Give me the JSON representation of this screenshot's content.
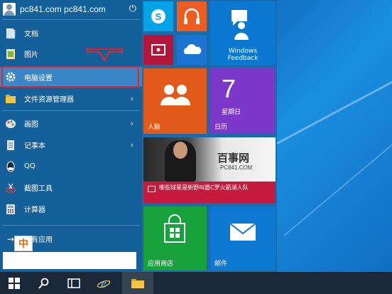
{
  "user": {
    "name": "pc841.com pc841.com"
  },
  "menu": {
    "items": [
      {
        "label": "文档",
        "icon": "documents-icon"
      },
      {
        "label": "图片",
        "icon": "pictures-icon"
      },
      {
        "label": "电脑设置",
        "icon": "gear-icon",
        "selected": true
      },
      {
        "label": "文件资源管理器",
        "icon": "folder-icon",
        "has_arrow": true
      },
      {
        "label": "画图",
        "icon": "paint-icon",
        "has_arrow": true
      },
      {
        "label": "记事本",
        "icon": "notepad-icon",
        "has_arrow": true
      },
      {
        "label": "QQ",
        "icon": "qq-icon"
      },
      {
        "label": "截图工具",
        "icon": "snipping-tool-icon"
      },
      {
        "label": "计算器",
        "icon": "calculator-icon"
      }
    ],
    "all_apps": "所有应用",
    "arrow_glyph": "›"
  },
  "ime": {
    "label": "中"
  },
  "tiles": {
    "feedback": {
      "label": "Windows\nFeedback"
    },
    "people": {
      "label": "人脉"
    },
    "calendar": {
      "label": "日历",
      "day": "7",
      "weekday": "星期日"
    },
    "news": {
      "caption": "哪些球星是新野叫嚣C罗火箭湖人队",
      "watermark": "百事网",
      "watermark_url": "PC841.COM"
    },
    "store": {
      "label": "应用商店"
    },
    "mail": {
      "label": "邮件"
    }
  },
  "colors": {
    "accent_red": "#e3262e",
    "menu_bg": "#14609b",
    "tile_area_bg": "#1d6aa8",
    "taskbar_bg": "#1a2838"
  }
}
